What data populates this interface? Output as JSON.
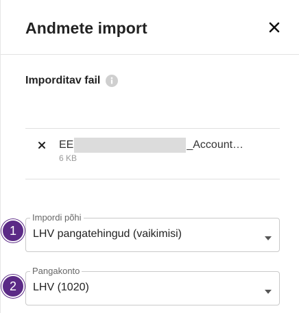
{
  "header": {
    "title": "Andmete import"
  },
  "file_section": {
    "label": "Imporditav fail",
    "file_name_prefix": "EE",
    "file_name_suffix": "_Account…",
    "file_size": "6 KB"
  },
  "template_field": {
    "step": "1",
    "label": "Impordi põhi",
    "value": "LHV pangatehingud (vaikimisi)"
  },
  "account_field": {
    "step": "2",
    "label": "Pangakonto",
    "value": "LHV (1020)"
  },
  "colors": {
    "step_badge": "#5b2a86",
    "text": "#222222",
    "muted": "#999999"
  },
  "icons": {
    "close": "close-icon",
    "info": "info-icon",
    "remove_file": "remove-file-icon",
    "caret": "chevron-down-icon"
  }
}
